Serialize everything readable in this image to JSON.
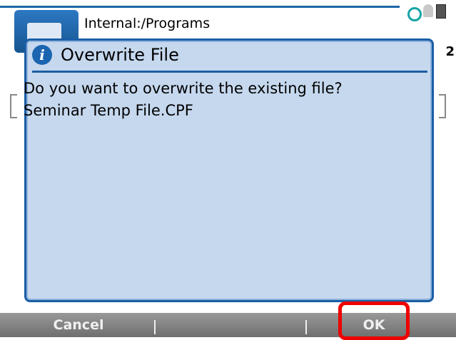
{
  "header": {
    "path": "Internal:/Programs",
    "right_char": "2"
  },
  "dialog": {
    "title": "Overwrite File",
    "message_line1": "Do you want to overwrite the existing file?",
    "message_line2": "Seminar Temp File.CPF"
  },
  "softkeys": {
    "left": "Cancel",
    "right": "OK"
  },
  "colors": {
    "dialog_border": "#1a5ea6",
    "dialog_bg": "#c5d8ee",
    "softkey_bar": "#7f7f7f",
    "highlight": "#ee0000"
  }
}
